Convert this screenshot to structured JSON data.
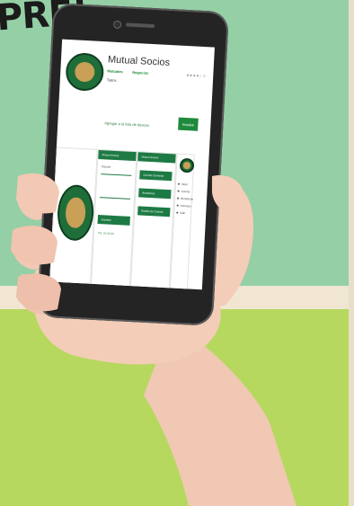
{
  "headline": "PRE!",
  "store_listing": {
    "app_name": "Mutual Socios",
    "developer": "Mutuales",
    "category": "Negocios",
    "rating_text": "★★★★☆ 2",
    "content_tag": "Todos",
    "wishlist_label": "Agregar a la lista de deseos",
    "install_label": "Instalar"
  },
  "screenshots": {
    "login_header": "Mutual Socios",
    "login_field_label": "Usuario",
    "login_button": "Ingresar",
    "login_footer": "Ver. 01.00.00",
    "menu_header": "Mutual Socios",
    "menu_items": [
      "Cuenta Corriente",
      "Beneficios",
      "Estado de Cuenta"
    ],
    "nav_items": [
      "Inicio",
      "Cuenta",
      "Beneficios",
      "Contacto",
      "Salir"
    ]
  },
  "colors": {
    "background_top": "#95cfa6",
    "background_bottom": "#b6d85e",
    "brand_green": "#1e7a44",
    "phone_body": "#242424"
  }
}
